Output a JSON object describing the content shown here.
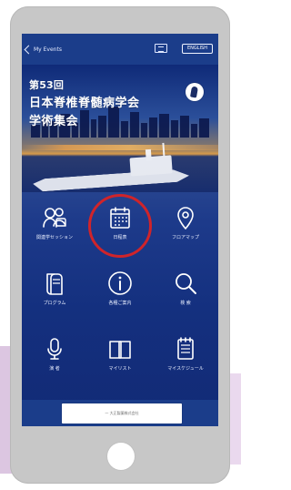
{
  "navbar": {
    "back_label": "My Events",
    "language_button_label": "ENGLISH"
  },
  "hero": {
    "title_line1": "第53回",
    "title_line2": "日本脊椎脊髄病学会",
    "title_line3": "学術集会",
    "logo": "society-seal-logo"
  },
  "menu": {
    "items": [
      {
        "label": "関連学セッション",
        "icon": "people-icon"
      },
      {
        "label": "日程表",
        "icon": "calendar-icon"
      },
      {
        "label": "フロアマップ",
        "icon": "map-pin-icon"
      },
      {
        "label": "プログラム",
        "icon": "book-icon"
      },
      {
        "label": "各種ご案内",
        "icon": "info-icon"
      },
      {
        "label": "検 索",
        "icon": "search-icon"
      },
      {
        "label": "演 者",
        "icon": "microphone-icon"
      },
      {
        "label": "マイリスト",
        "icon": "open-book-icon"
      },
      {
        "label": "マイスケジュール",
        "icon": "notepad-icon"
      }
    ],
    "highlighted_item": "日程表",
    "highlight_color": "#d0242a"
  },
  "footer": {
    "button_label": "一 大正製薬株式会社"
  }
}
